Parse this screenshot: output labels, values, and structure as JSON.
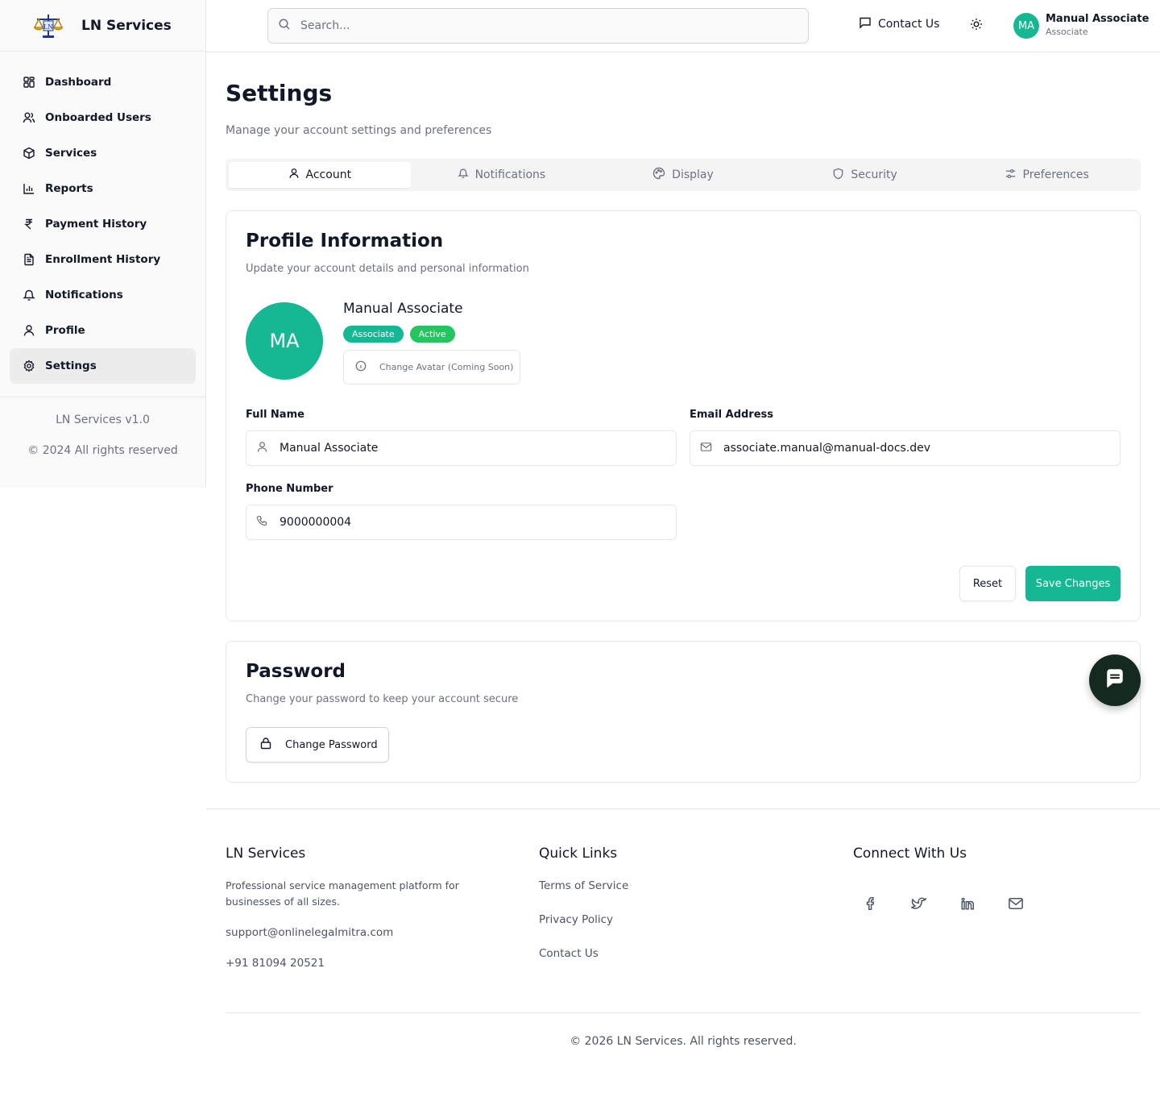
{
  "sidebar": {
    "brand": "LN Services",
    "items": [
      {
        "label": "Dashboard",
        "icon": "dashboard-icon"
      },
      {
        "label": "Onboarded Users",
        "icon": "users-icon"
      },
      {
        "label": "Services",
        "icon": "package-icon"
      },
      {
        "label": "Reports",
        "icon": "bar-chart-icon"
      },
      {
        "label": "Payment History",
        "icon": "rupee-icon"
      },
      {
        "label": "Enrollment History",
        "icon": "file-text-icon"
      },
      {
        "label": "Notifications",
        "icon": "bell-icon"
      },
      {
        "label": "Profile",
        "icon": "user-icon"
      },
      {
        "label": "Settings",
        "icon": "gear-icon",
        "active": true
      }
    ],
    "version": "LN Services v1.0",
    "copyright": "© 2024 All rights reserved"
  },
  "topbar": {
    "search_placeholder": "Search...",
    "contact_label": "Contact Us",
    "user_initials": "MA",
    "user_name": "Manual Associate",
    "user_role": "Associate"
  },
  "page": {
    "title": "Settings",
    "subtitle": "Manage your account settings and preferences"
  },
  "tabs": [
    {
      "label": "Account",
      "icon": "user-icon",
      "active": true
    },
    {
      "label": "Notifications",
      "icon": "bell-icon"
    },
    {
      "label": "Display",
      "icon": "palette-icon"
    },
    {
      "label": "Security",
      "icon": "shield-icon"
    },
    {
      "label": "Preferences",
      "icon": "sliders-icon"
    }
  ],
  "profile": {
    "title": "Profile Information",
    "subtitle": "Update your account details and personal information",
    "initials": "MA",
    "name": "Manual Associate",
    "badges": [
      "Associate",
      "Active"
    ],
    "change_avatar_label": "Change Avatar (Coming Soon)",
    "full_name_label": "Full Name",
    "full_name_value": "Manual Associate",
    "email_label": "Email Address",
    "email_value": "associate.manual@manual-docs.dev",
    "phone_label": "Phone Number",
    "phone_value": "9000000004",
    "reset_label": "Reset",
    "save_label": "Save Changes"
  },
  "password": {
    "title": "Password",
    "subtitle": "Change your password to keep your account secure",
    "button_label": "Change Password"
  },
  "footer": {
    "brand_title": "LN Services",
    "brand_desc": "Professional service management platform for businesses of all sizes.",
    "email": "support@onlinelegalmitra.com",
    "phone": "+91 81094 20521",
    "links_title": "Quick Links",
    "links": [
      "Terms of Service",
      "Privacy Policy",
      "Contact Us"
    ],
    "connect_title": "Connect With Us",
    "socials": [
      "facebook-icon",
      "twitter-icon",
      "linkedin-icon",
      "mail-icon"
    ],
    "copyright": "© 2026 LN Services. All rights reserved."
  },
  "colors": {
    "accent": "#16b894",
    "active_badge": "#22c55e",
    "chat_button": "#14291f"
  }
}
